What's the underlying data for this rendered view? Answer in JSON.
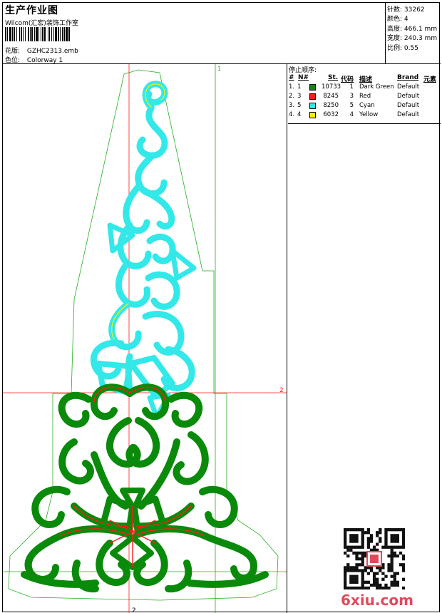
{
  "header": {
    "title": "生产作业图",
    "company": "Wilcom(汇宏)装饰工作室",
    "design_label": "花版:",
    "design_value": "GZHC2313.emb",
    "colorway_label": "色位:",
    "colorway_value": "Colorway 1"
  },
  "stats": {
    "stitches_label": "针数:",
    "stitches_value": "33262",
    "colors_label": "颜色:",
    "colors_value": "4",
    "height_label": "高度:",
    "height_value": "466.1 mm",
    "width_label": "宽度:",
    "width_value": "240.3 mm",
    "scale_label": "比例:",
    "scale_value": "0.55"
  },
  "stop_sequence": {
    "title": "停止顺序:",
    "headers": [
      "#",
      "N#",
      "St.",
      "代码",
      "描述",
      "Brand",
      "元素"
    ],
    "rows": [
      {
        "idx": "1.",
        "n": "1",
        "color": "#0a8a0a",
        "st": "10733",
        "code": "1",
        "desc": "Dark Green",
        "brand": "Default"
      },
      {
        "idx": "2.",
        "n": "3",
        "color": "#ff1a1a",
        "st": "8245",
        "code": "3",
        "desc": "Red",
        "brand": "Default"
      },
      {
        "idx": "3.",
        "n": "5",
        "color": "#33e8e8",
        "st": "8250",
        "code": "5",
        "desc": "Cyan",
        "brand": "Default"
      },
      {
        "idx": "4.",
        "n": "4",
        "color": "#f2f200",
        "st": "6032",
        "code": "4",
        "desc": "Yellow",
        "brand": "Default"
      }
    ]
  },
  "guides": {
    "top_marker": "1",
    "right_marker": "2",
    "bottom_marker": "2"
  },
  "colors": {
    "dark_green": "#0a8a0a",
    "red": "#ff1a1a",
    "cyan": "#33e8e8",
    "yellow": "#f2f200",
    "guide_green": "#22b022",
    "watermark": "#e14a5a"
  },
  "watermark": {
    "text": "6xiu.com"
  }
}
